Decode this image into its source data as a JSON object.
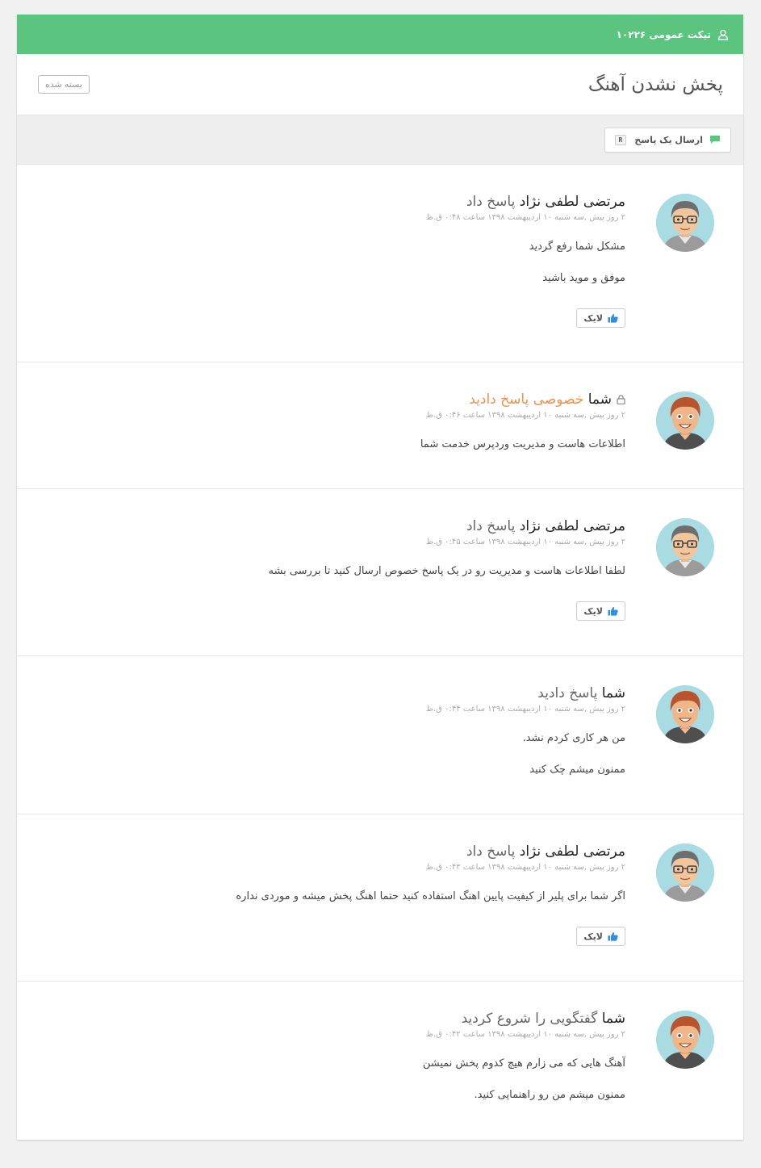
{
  "header": {
    "ticket_label": "تیکت عمومی ۱۰۲۲۶",
    "icon": "user-icon",
    "color": "#5bc47e"
  },
  "ticket": {
    "title": "پخش نشدن آهنگ",
    "status_button": "بسته شده"
  },
  "toolbar": {
    "reply_label": "ارسال یک پاسخ",
    "reply_shortcut": "R",
    "icon": "chat-icon"
  },
  "like_label": "لایک",
  "posts": [
    {
      "author": "مرتضی لطفی نژاد",
      "action": "پاسخ داد",
      "private": false,
      "avatar": "support-avatar",
      "meta": "۲ روز پیش ,سه شنبه ۱۰ اردیبهشت ۱۳۹۸ ساعت ۰:۴۸ ق.ظ",
      "paragraphs": [
        "مشکل شما رفع گردید",
        "موفق و موید باشید"
      ],
      "likeable": true
    },
    {
      "author": "شما",
      "action": "خصوصی پاسخ دادید",
      "private": true,
      "avatar": "user-avatar",
      "meta": "۲ روز پیش ,سه شنبه ۱۰ اردیبهشت ۱۳۹۸ ساعت ۰:۴۶ ق.ظ",
      "paragraphs": [
        "اطلاعات هاست و مدیریت وردپرس خدمت شما"
      ],
      "likeable": false
    },
    {
      "author": "مرتضی لطفی نژاد",
      "action": "پاسخ داد",
      "private": false,
      "avatar": "support-avatar",
      "meta": "۲ روز پیش ,سه شنبه ۱۰ اردیبهشت ۱۳۹۸ ساعت ۰:۴۵ ق.ظ",
      "paragraphs": [
        "لطفا اطلاعات هاست و مدیریت رو در یک پاسخ خصوص ارسال کنید تا بررسی بشه"
      ],
      "likeable": true
    },
    {
      "author": "شما",
      "action": "پاسخ دادید",
      "private": false,
      "avatar": "user-avatar",
      "meta": "۲ روز پیش ,سه شنبه ۱۰ اردیبهشت ۱۳۹۸ ساعت ۰:۴۴ ق.ظ",
      "paragraphs": [
        "من هر کاری کردم نشد.",
        "ممنون میشم چک کنید"
      ],
      "likeable": false
    },
    {
      "author": "مرتضی لطفی نژاد",
      "action": "پاسخ داد",
      "private": false,
      "avatar": "support-avatar",
      "meta": "۲ روز پیش ,سه شنبه ۱۰ اردیبهشت ۱۳۹۸ ساعت ۰:۴۳ ق.ظ",
      "paragraphs": [
        "اگر شما برای پلیر از کیفیت پایین اهنگ استفاده کنید حتما اهنگ پخش میشه و موردی نداره"
      ],
      "likeable": true
    },
    {
      "author": "شما",
      "action": "گفتگویی را شروع کردید",
      "private": false,
      "avatar": "user-avatar",
      "meta": "۲ روز پیش ,سه شنبه ۱۰ اردیبهشت ۱۳۹۸ ساعت ۰:۴۲ ق.ظ",
      "paragraphs": [
        "آهنگ هایی که می زارم هیچ کدوم پخش نمیشن",
        "ممنون میشم من رو راهنمایی کنید."
      ],
      "likeable": false
    }
  ]
}
